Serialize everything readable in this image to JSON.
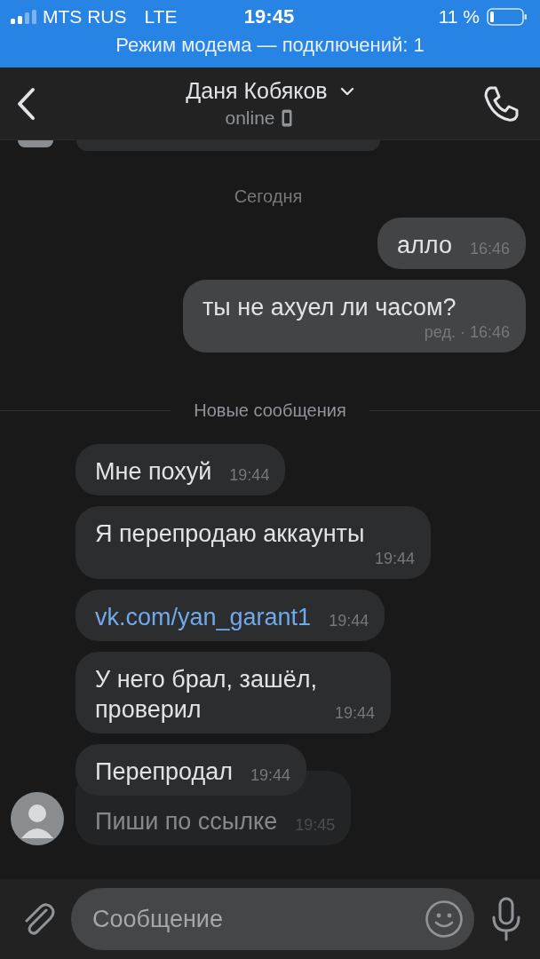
{
  "status_bar": {
    "carrier": "MTS RUS",
    "network": "LTE",
    "time": "19:45",
    "battery": "11 %"
  },
  "hotspot_banner": "Режим модема — подключений: 1",
  "header": {
    "name": "Даня Кобяков",
    "status": "online"
  },
  "today": {
    "label": "Сегодня",
    "messages": [
      {
        "outgoing": true,
        "text": "алло",
        "time": "16:46"
      },
      {
        "outgoing": true,
        "text": "ты не ахуел ли часом?",
        "edited": "ред. ·",
        "time": "16:46"
      }
    ]
  },
  "new": {
    "label": "Новые сообщения",
    "messages": [
      {
        "outgoing": false,
        "link": false,
        "appearing": false,
        "show_avatar": false,
        "text": "Мне похуй",
        "time": "19:44"
      },
      {
        "outgoing": false,
        "link": false,
        "appearing": false,
        "show_avatar": false,
        "text": "Я перепродаю аккаунты",
        "time": "19:44"
      },
      {
        "outgoing": false,
        "link": true,
        "appearing": false,
        "show_avatar": false,
        "text": "vk.com/yan_garant1",
        "time": "19:44"
      },
      {
        "outgoing": false,
        "link": false,
        "appearing": false,
        "show_avatar": false,
        "text": "У него брал, зашёл,\nпроверил",
        "time": "19:44"
      },
      {
        "outgoing": false,
        "link": false,
        "appearing": false,
        "show_avatar": false,
        "text": "Перепродал",
        "time": "19:44"
      },
      {
        "outgoing": false,
        "link": false,
        "appearing": true,
        "show_avatar": true,
        "text": "Пиши по ссылке",
        "time": "19:45"
      }
    ]
  },
  "input": {
    "placeholder": "Сообщение"
  }
}
